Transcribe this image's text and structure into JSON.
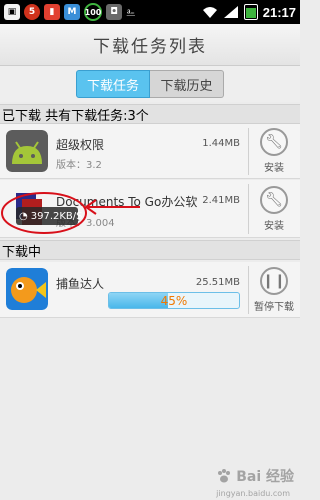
{
  "status_bar": {
    "notif_count": "5",
    "battery_level": "100",
    "time": "21:17",
    "icons": [
      "white-app-icon",
      "red-badge-icon",
      "red-app-icon",
      "blue-app-icon",
      "battery-100-icon",
      "bag-icon",
      "usb-icon",
      "wifi-icon",
      "signal-icon",
      "battery-icon"
    ]
  },
  "header": {
    "title": "下载任务列表"
  },
  "tabs": [
    {
      "label": "下载任务",
      "active": true
    },
    {
      "label": "下载历史",
      "active": false
    }
  ],
  "downloaded": {
    "section_label": "已下载 共有下载任务:3个",
    "items": [
      {
        "name": "超级权限",
        "version": "版本：3.2",
        "size": "1.44MB",
        "action": "安装",
        "icon": "android-superuser-icon"
      },
      {
        "name": "Documents To Go办公软",
        "version": "版本：3.004",
        "size": "2.41MB",
        "action": "安装",
        "icon": "documents-to-go-icon"
      }
    ],
    "speed_overlay": "397.2KB/S"
  },
  "downloading": {
    "section_label": "下载中",
    "items": [
      {
        "name": "捕鱼达人",
        "size": "25.51MB",
        "progress_percent": 45,
        "progress_label": "45%",
        "action": "暂停下载",
        "icon": "fishing-joy-icon"
      }
    ]
  },
  "watermark": {
    "text": "Bai 经验",
    "sub": "jingyan.baidu.com"
  },
  "colors": {
    "accent": "#5ac3ef",
    "progress_text": "#f07800",
    "annotation": "#d8101a"
  }
}
